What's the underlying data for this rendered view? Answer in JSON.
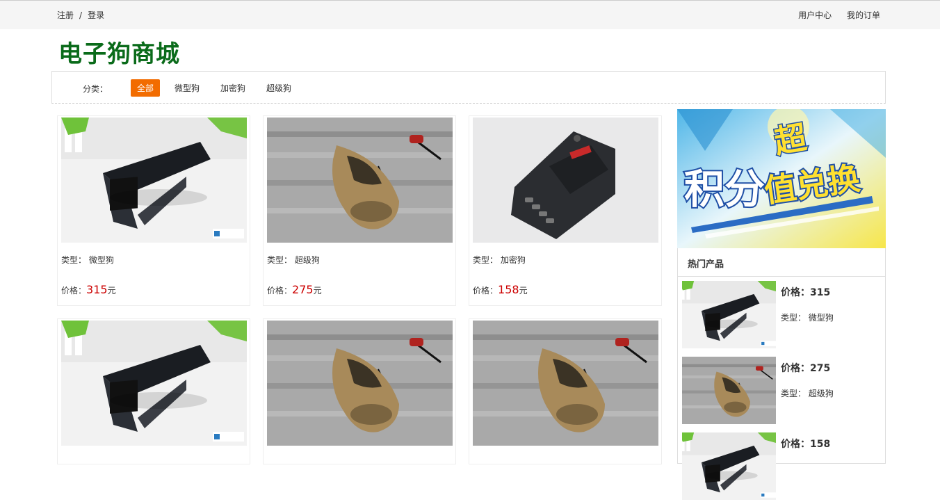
{
  "topbar": {
    "register": "注册",
    "separator": "/",
    "login": "登录",
    "user_center": "用户中心",
    "my_orders": "我的订单"
  },
  "logo": "电子狗商城",
  "categories": {
    "label": "分类：",
    "items": [
      "全部",
      "微型狗",
      "加密狗",
      "超级狗"
    ],
    "active": "全部"
  },
  "products": [
    {
      "type_label": "类型：",
      "type": "微型狗",
      "price_label": "价格：",
      "price": "315",
      "unit": "元",
      "image": "micro-dog-device"
    },
    {
      "type_label": "类型：",
      "type": "超级狗",
      "price_label": "价格：",
      "price": "275",
      "unit": "元",
      "image": "car-shaped-device"
    },
    {
      "type_label": "类型：",
      "type": "加密狗",
      "price_label": "价格：",
      "price": "158",
      "unit": "元",
      "image": "black-radar-device"
    },
    {
      "image": "micro-dog-device"
    },
    {
      "image": "car-shaped-device"
    },
    {
      "image": "car-shaped-device"
    }
  ],
  "banner": {
    "line1": "积分",
    "line2": "超",
    "line3": "值兑换"
  },
  "hot": {
    "title": "热门产品",
    "items": [
      {
        "price": "价格：315",
        "type": "类型：  微型狗",
        "image": "micro-dog-device"
      },
      {
        "price": "价格：275",
        "type": "类型：  超级狗",
        "image": "car-shaped-device"
      },
      {
        "price": "价格：158",
        "image": "black-radar-device"
      }
    ]
  },
  "colors": {
    "accent": "#f26c00",
    "logo": "#0a6b1a",
    "price": "#cc0000"
  }
}
